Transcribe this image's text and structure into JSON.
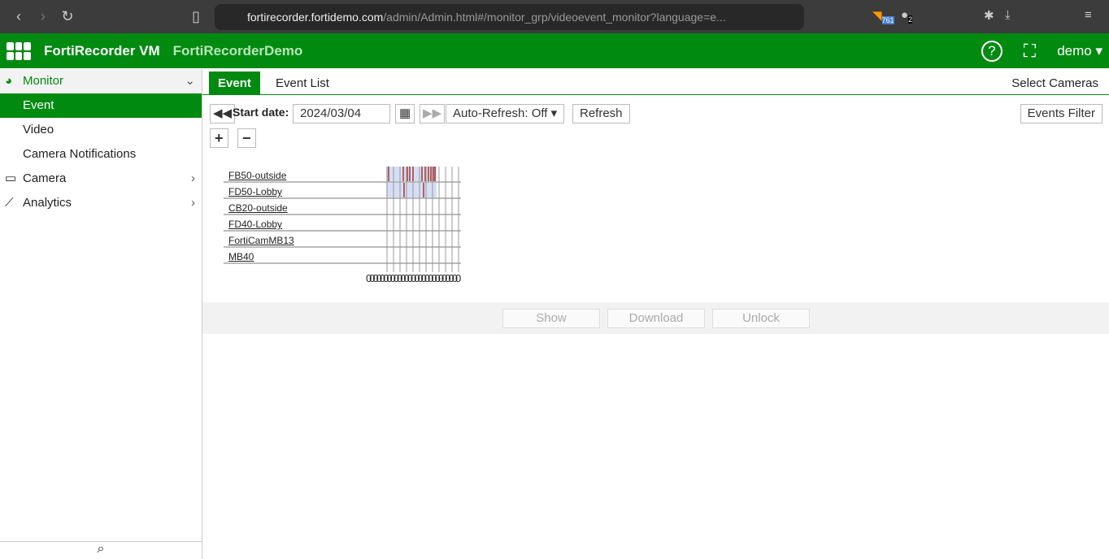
{
  "browser": {
    "url_host": "fortirecorder.fortidemo.com",
    "url_path": "/admin/Admin.html#/monitor_grp/videoevent_monitor?language=e...",
    "badge_rss": "761",
    "badge_ext": "2"
  },
  "header": {
    "product": "FortiRecorder VM",
    "device": "FortiRecorderDemo",
    "user": "demo",
    "accent": "#008a10"
  },
  "sidebar": {
    "monitor": "Monitor",
    "items": [
      "Event",
      "Video",
      "Camera Notifications"
    ],
    "camera": "Camera",
    "analytics": "Analytics"
  },
  "tabs": {
    "event": "Event",
    "event_list": "Event List",
    "select_cameras": "Select Cameras"
  },
  "toolbar": {
    "start_label": "Start date:",
    "start_value": "2024/03/04",
    "auto_refresh": "Auto-Refresh: Off",
    "refresh": "Refresh",
    "events_filter": "Events Filter",
    "zoom_in": "+",
    "zoom_out": "−"
  },
  "cameras": [
    "FB50-outside",
    "FD50-Lobby",
    "CB20-outside",
    "FD40-Lobby",
    "FortiCamMB13",
    "MB40"
  ],
  "timeline_axis": "000000000000000000000000000",
  "actions": {
    "show": "Show",
    "download": "Download",
    "unlock": "Unlock"
  }
}
